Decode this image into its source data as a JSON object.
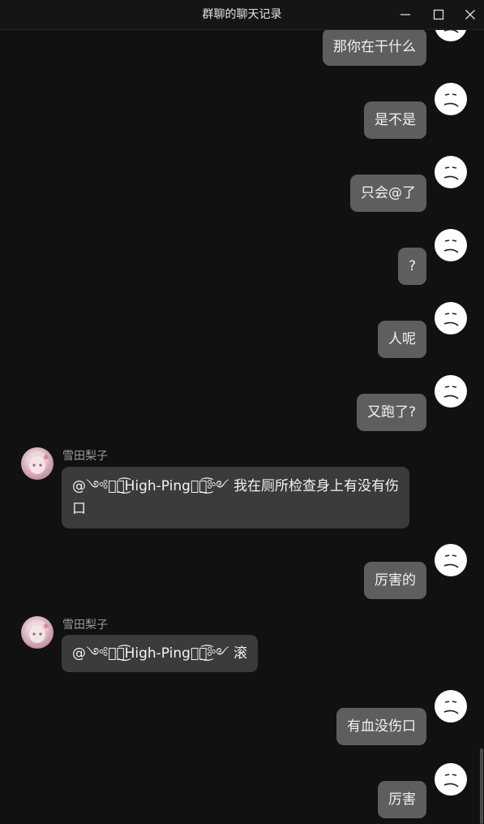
{
  "window": {
    "title": "群聊的聊天记录",
    "minimize_icon": "minimize-icon",
    "maximize_icon": "maximize-icon",
    "close_icon": "close-icon"
  },
  "colors": {
    "background": "#111111",
    "outgoing_bubble": "#5e5e5e",
    "incoming_bubble": "#3b3b3b",
    "text": "#f2f2f2",
    "sender_name": "#9a9a9a"
  },
  "messages": [
    {
      "side": "right",
      "text": "那你在干什么"
    },
    {
      "side": "right",
      "text": "是不是"
    },
    {
      "side": "right",
      "text": "只会@了"
    },
    {
      "side": "right",
      "text": "?"
    },
    {
      "side": "right",
      "text": "人呢"
    },
    {
      "side": "right",
      "text": "又跑了?"
    },
    {
      "side": "left",
      "sender": "雪田梨子",
      "text_line1": "@༺ৡৢ͜͡High-Pingৡৢ͜͡༻ 我在厕所检查身上有没有伤",
      "text_line2": "口"
    },
    {
      "side": "right",
      "text": "厉害的"
    },
    {
      "side": "left",
      "sender": "雪田梨子",
      "text_line1": "@༺ৡৢ͜͡High-Pingৡৢ͜͡༻ 滚"
    },
    {
      "side": "right",
      "text": "有血没伤口"
    },
    {
      "side": "right",
      "text": "厉害"
    }
  ]
}
